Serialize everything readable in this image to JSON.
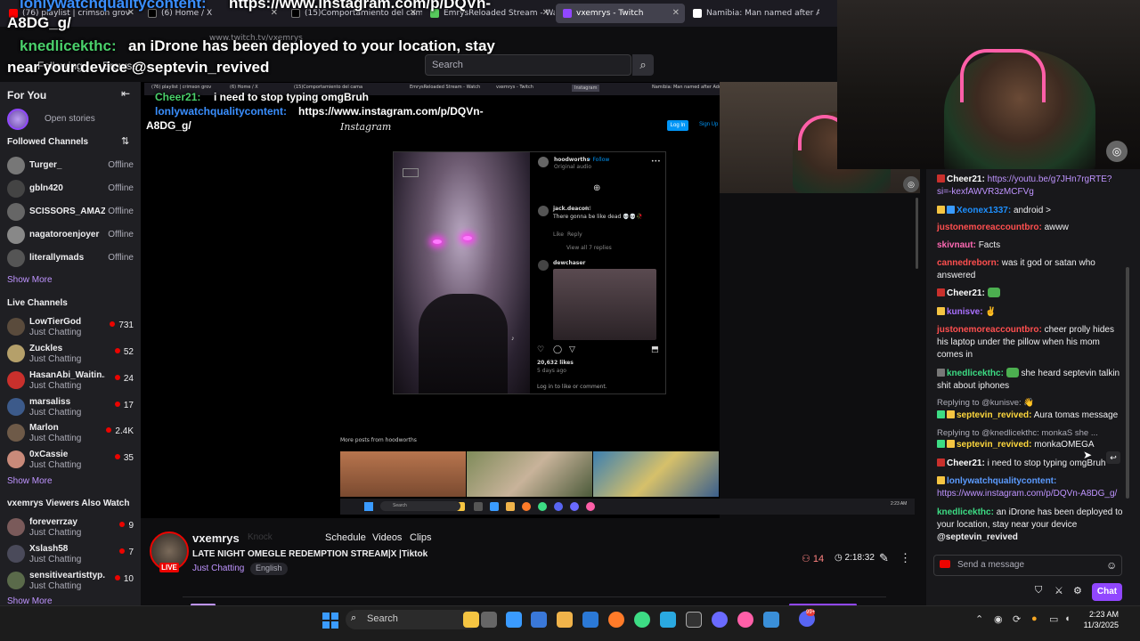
{
  "browser": {
    "tabs": [
      {
        "label": "(76) playlist | crimson grov",
        "color": "#ff0000"
      },
      {
        "label": "(6) Home / X",
        "color": "#000000"
      },
      {
        "label": "(15)Comportamiento del cama",
        "color": "#000000"
      },
      {
        "label": "EmrysReloaded Stream - Watch",
        "color": "#57c95d"
      },
      {
        "label": "vxemrys - Twitch",
        "color": "#9147ff",
        "active": true
      },
      {
        "label": "Namibia: Man named after Ado",
        "color": "#ffffff"
      }
    ],
    "url": "www.twitch.tv/vxemrys"
  },
  "overlay": {
    "line1_user": "lonlywatchqualitycontent:",
    "line1_text": "https://www.instagram.com/p/DQVn-",
    "line1_cont": "A8DG_g/",
    "line2_user": "knedlicekthc:",
    "line2_text": "an iDrone has been deployed to your location, stay",
    "line3": "near your device @septevin_revived"
  },
  "twitch_nav": {
    "following": "Following",
    "browse": "Browse",
    "search_placeholder": "Search"
  },
  "sidebar": {
    "for_you": "For You",
    "open_stories": "Open stories",
    "followed_title": "Followed Channels",
    "followed": [
      {
        "name": "Turger_",
        "status": "Offline"
      },
      {
        "name": "gbln420",
        "status": "Offline"
      },
      {
        "name": "SCISSORS_AMAZ...",
        "status": "Offline"
      },
      {
        "name": "nagatoroenjoyer",
        "status": "Offline"
      },
      {
        "name": "literallymads",
        "status": "Offline"
      }
    ],
    "show_more_1": "Show More",
    "live_title": "Live Channels",
    "live": [
      {
        "name": "LowTierGod",
        "category": "Just Chatting",
        "viewers": "731"
      },
      {
        "name": "Zuckles",
        "category": "Just Chatting",
        "viewers": "52"
      },
      {
        "name": "HasanAbi_Waitin...",
        "category": "Just Chatting",
        "viewers": "24"
      },
      {
        "name": "marsaliss",
        "category": "Just Chatting",
        "viewers": "17"
      },
      {
        "name": "Marlon",
        "category": "Just Chatting",
        "viewers": "2.4K"
      },
      {
        "name": "0xCassie",
        "category": "Just Chatting",
        "viewers": "35"
      }
    ],
    "show_more_2": "Show More",
    "also_watch_title": "vxemrys Viewers Also Watch",
    "also_watch": [
      {
        "name": "foreverrzay",
        "category": "Just Chatting",
        "viewers": "9"
      },
      {
        "name": "Xslash58",
        "category": "Just Chatting",
        "viewers": "7"
      },
      {
        "name": "sensitiveartisttyp...",
        "category": "Just Chatting",
        "viewers": "10"
      }
    ],
    "show_more_3": "Show More"
  },
  "inner_screen": {
    "overlay_user": "lonlywatchqualitycontent:",
    "overlay_url": "https://www.instagram.com/p/DQVn-",
    "overlay_cont": "A8DG_g/",
    "overlay_top_user": "Cheer21:",
    "overlay_top_text": "i need to stop typing omgBruh",
    "instagram": "Instagram",
    "login": "Log In",
    "signup": "Sign Up",
    "post_user": "hoodworths",
    "post_follow": "• Follow",
    "post_audio": "Original audio",
    "comment1_user": "jack.deacon",
    "comment1_age": "4d",
    "comment1_text": "There gonna be like dead 💀💀🥀",
    "comment1_like": "Like",
    "comment1_reply": "Reply",
    "view_replies": "View all 7 replies",
    "comment2_user": "dewchaser",
    "likes": "20,632 likes",
    "posted": "5 days ago",
    "login_prompt": "Log in to like or comment.",
    "more_posts": "More posts from hoodworths",
    "taskbar_search": "Search",
    "time": "2:23 AM\n11/3/2025"
  },
  "stream": {
    "channel": "vxemrys",
    "knock": "Knock",
    "tabs": [
      "Schedule",
      "Videos",
      "Clips"
    ],
    "title": "LATE NIGHT OMEGLE REDEMPTION STREAM|X |Tiktok",
    "category": "Just Chatting",
    "tag": "English",
    "live": "LIVE",
    "viewers": "14",
    "uptime": "2:18:32"
  },
  "chat": {
    "messages": [
      {
        "user": "Cheer21:",
        "text": "https://youtu.be/g7JHn7rgRTE?si=-kexfAWVR3zMCFVg",
        "user_color": "#ffffff",
        "text_color": "#bf94ff"
      },
      {
        "user": "Xeonex1337:",
        "text": "android >",
        "user_color": "#1e90ff"
      },
      {
        "user": "justonemoreaccountbro:",
        "text": "awww",
        "user_color": "#ff4f4f"
      },
      {
        "user": "skivnaut:",
        "text": "Facts",
        "user_color": "#ff69b4"
      },
      {
        "user": "cannedreborn:",
        "text": "was it god or satan who answered",
        "user_color": "#ff4f4f"
      },
      {
        "user": "Cheer21:",
        "text": "",
        "user_color": "#ffffff"
      },
      {
        "user": "kunisve:",
        "text": "",
        "user_color": "#a970ff"
      },
      {
        "user": "justonemoreaccountbro:",
        "text": "cheer prolly hides his laptop under the pillow when his mom comes in",
        "user_color": "#ff4f4f"
      },
      {
        "user": "knedlicekthc:",
        "text": "she heard septevin talkin shit about iphones",
        "user_color": "#3ddc84"
      },
      {
        "reply": "Replying to @kunisve: 👋",
        "user": "septevin_revived:",
        "text": "Aura tomas message",
        "user_color": "#ffd83d"
      },
      {
        "reply": "Replying to @knedlicekthc: monkaS she ...",
        "user": "septevin_revived:",
        "text": "monkaOMEGA",
        "user_color": "#ffd83d"
      },
      {
        "user": "Cheer21:",
        "text": "i need to stop typing omgBruh",
        "user_color": "#ffffff"
      },
      {
        "user": "lonlywatchqualitycontent:",
        "text": "https://www.instagram.com/p/DQVn-A8DG_g/",
        "user_color": "#5b9bff",
        "text_color": "#bf94ff"
      },
      {
        "user": "knedlicekthc:",
        "text": "an iDrone has been deployed to your location, stay near your device",
        "mention": "@septevin_revived",
        "user_color": "#3ddc84"
      }
    ],
    "input_placeholder": "Send a message",
    "chat_button": "Chat"
  },
  "taskbar": {
    "search": "Search",
    "time": "2:23 AM",
    "date": "11/3/2025",
    "notify_count": "99+"
  },
  "colors": {
    "twitch_purple": "#9147ff",
    "live_red": "#eb0400",
    "link_purple": "#bf94ff"
  }
}
